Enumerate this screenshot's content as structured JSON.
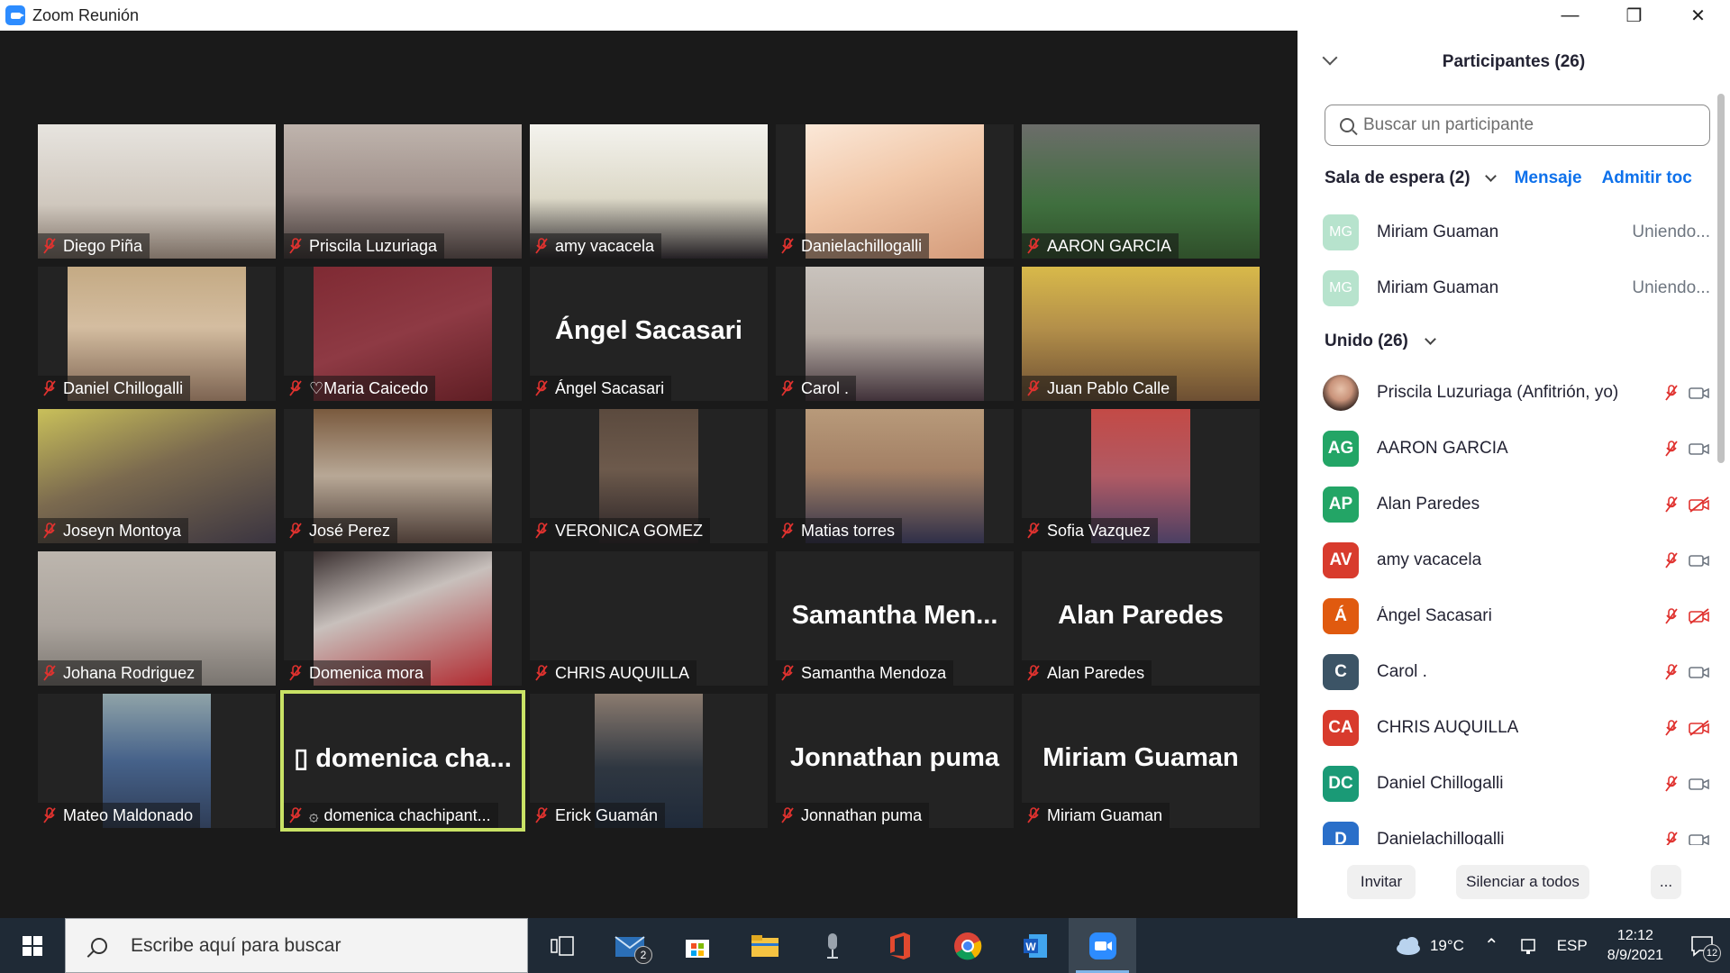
{
  "window": {
    "title": "Zoom Reunión"
  },
  "tiles": [
    {
      "name": "Diego Piña",
      "feed": "f1",
      "full": true
    },
    {
      "name": "Priscila Luzuriaga",
      "feed": "f2",
      "full": true
    },
    {
      "name": "amy vacacela",
      "feed": "f3",
      "full": true
    },
    {
      "name": "Danielachillogalli",
      "feed": "f4"
    },
    {
      "name": "AARON GARCIA",
      "feed": "f5",
      "full": true
    },
    {
      "name": "Daniel  Chillogalli",
      "feed": "f6"
    },
    {
      "name": "♡Maria Caicedo",
      "feed": "f7"
    },
    {
      "name": "Ángel Sacasari",
      "big": "Ángel Sacasari"
    },
    {
      "name": "Carol .",
      "feed": "f8"
    },
    {
      "name": "Juan Pablo Calle",
      "feed": "f9",
      "full": true
    },
    {
      "name": "Joseyn Montoya",
      "feed": "f10",
      "full": true
    },
    {
      "name": "José Perez",
      "feed": "f11"
    },
    {
      "name": "VERONICA GOMEZ",
      "feed": "f12"
    },
    {
      "name": "Matias torres",
      "feed": "f13"
    },
    {
      "name": "Sofia Vazquez",
      "feed": "f14"
    },
    {
      "name": "Johana Rodriguez",
      "feed": "f15",
      "full": true
    },
    {
      "name": "Domenica mora",
      "feed": "f16"
    },
    {
      "name": "CHRIS AUQUILLA"
    },
    {
      "name": "Samantha Mendoza",
      "big": "Samantha  Men..."
    },
    {
      "name": "Alan Paredes",
      "big": "Alan Paredes"
    },
    {
      "name": "Mateo Maldonado",
      "feed": "f17"
    },
    {
      "name": "domenica chachipant...",
      "big": "▯ domenica  cha...",
      "active": true,
      "prefix": "۞"
    },
    {
      "name": "Erick Guamán",
      "feed": "f18"
    },
    {
      "name": "Jonnathan puma",
      "big": "Jonnathan puma"
    },
    {
      "name": "Miriam Guaman",
      "big": "Miriam Guaman"
    }
  ],
  "panel": {
    "title": "Participantes (26)",
    "search_placeholder": "Buscar un participante",
    "waiting_label": "Sala de espera (2)",
    "message_label": "Mensaje",
    "admit_label": "Admitir toc",
    "waiting": [
      {
        "initials": "MG",
        "name": "Miriam Guaman",
        "status": "Uniendo..."
      },
      {
        "initials": "MG",
        "name": "Miriam Guaman",
        "status": "Uniendo..."
      }
    ],
    "joined_label": "Unido (26)",
    "joined": [
      {
        "initials": "",
        "name": "Priscila Luzuriaga (Anfitrión, yo)",
        "color": "photo",
        "video_off": false
      },
      {
        "initials": "AG",
        "name": "AARON GARCIA",
        "color": "#23a566",
        "video_off": false
      },
      {
        "initials": "AP",
        "name": "Alan Paredes",
        "color": "#23a566",
        "video_off": true
      },
      {
        "initials": "AV",
        "name": "amy vacacela",
        "color": "#d83b2d",
        "video_off": false
      },
      {
        "initials": "Á",
        "name": "Ángel Sacasari",
        "color": "#e05a0f",
        "video_off": true
      },
      {
        "initials": "C",
        "name": "Carol .",
        "color": "#3c5466",
        "video_off": false
      },
      {
        "initials": "CA",
        "name": "CHRIS AUQUILLA",
        "color": "#d83b2d",
        "video_off": true
      },
      {
        "initials": "DC",
        "name": "Daniel  Chillogalli",
        "color": "#1a9a76",
        "video_off": false
      },
      {
        "initials": "D",
        "name": "Danielachillogalli",
        "color": "#2a6fc9",
        "video_off": false
      }
    ],
    "buttons": {
      "invite": "Invitar",
      "mute_all": "Silenciar a todos",
      "more": "..."
    }
  },
  "taskbar": {
    "search_text": "Escribe aquí para buscar",
    "mail_badge": "2",
    "weather": "19°C",
    "lang": "ESP",
    "time": "12:12",
    "date": "8/9/2021",
    "notif_count": "12"
  },
  "colors": {
    "accent": "#0e71eb",
    "active_speaker": "#c9e265",
    "mic_muted": "#e0322f"
  }
}
